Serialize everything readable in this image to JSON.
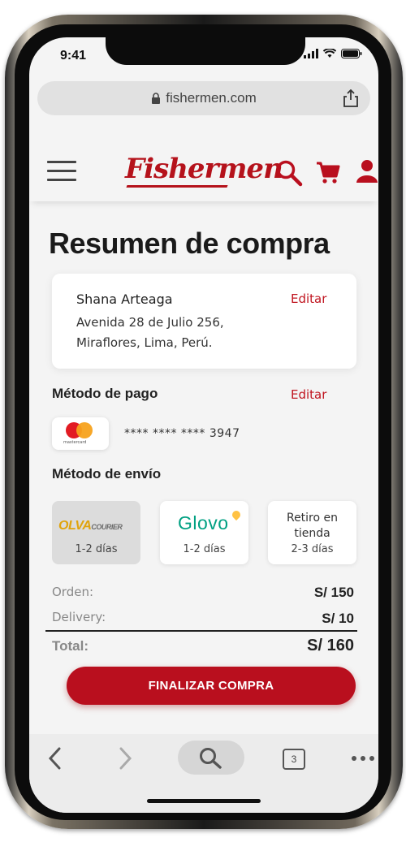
{
  "status_bar": {
    "time": "9:41"
  },
  "browser": {
    "url": "fishermen.com"
  },
  "header": {
    "logo_text": "Fishermen"
  },
  "page": {
    "title": "Resumen de compra"
  },
  "address": {
    "name": "Shana Arteaga",
    "line1": "Avenida 28 de Julio 256,",
    "line2": "Miraflores, Lima, Perú.",
    "edit_label": "Editar"
  },
  "payment": {
    "section_label": "Método de pago",
    "edit_label": "Editar",
    "card_brand": "mastercard",
    "card_number": "**** **** **** 3947"
  },
  "shipping": {
    "section_label": "Método de envío",
    "options": [
      {
        "logo": "OLVA",
        "logo_suffix": "COURIER",
        "days": "1-2 días",
        "selected": true
      },
      {
        "logo": "Glovo",
        "days": "1-2 días",
        "selected": false
      },
      {
        "label": "Retiro en tienda",
        "days": "2-3 días",
        "selected": false
      }
    ]
  },
  "summary": {
    "order_label": "Orden:",
    "order_value": "S/ 150",
    "delivery_label": "Delivery:",
    "delivery_value": "S/ 10",
    "total_label": "Total:",
    "total_value": "S/ 160"
  },
  "cta": {
    "label": "FINALIZAR COMPRA"
  },
  "browser_nav": {
    "tabs_count": "3"
  },
  "colors": {
    "brand": "#b90f1e",
    "olva": "#e0a40c",
    "glovo": "#00a082"
  }
}
